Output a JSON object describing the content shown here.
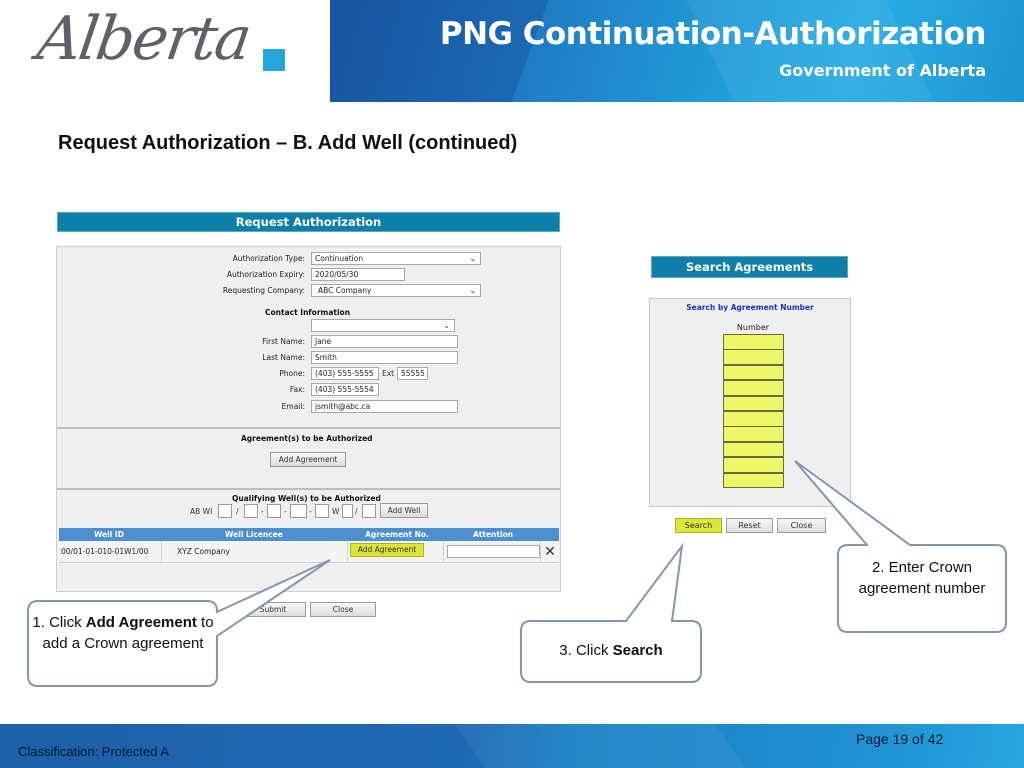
{
  "header": {
    "logo_text": "Alberta",
    "title": "PNG Continuation-Authorization",
    "subtitle": "Government of Alberta"
  },
  "slide_heading": "Request Authorization – B. Add Well (continued)",
  "request_form": {
    "title": "Request Authorization",
    "fields": {
      "authorization_type": {
        "label": "Authorization Type:",
        "value": "Continuation"
      },
      "authorization_expiry": {
        "label": "Authorization Expiry:",
        "value": "2020/05/30"
      },
      "requesting_company": {
        "label": "Requesting Company:",
        "value": "ABC Company"
      }
    },
    "contact": {
      "heading": "Contact Information",
      "contact_select_value": "",
      "first_name": {
        "label": "First Name:",
        "value": "Jane"
      },
      "last_name": {
        "label": "Last Name:",
        "value": "Smith"
      },
      "phone": {
        "label": "Phone:",
        "value": "(403) 555-5555",
        "ext_label": "Ext",
        "ext_value": "55555"
      },
      "fax": {
        "label": "Fax:",
        "value": "(403) 555-5554"
      },
      "email": {
        "label": "Email:",
        "value": "jsmith@abc.ca"
      }
    },
    "agreements": {
      "heading": "Agreement(s) to be Authorized",
      "add_button": "Add Agreement"
    },
    "wells": {
      "heading": "Qualifying Well(s) to be Authorized",
      "prefix": "AB WI",
      "sep_slash": "/",
      "sep_dash": "-",
      "sep_w": "W",
      "add_button": "Add Well",
      "columns": [
        "Well ID",
        "Well Licencee",
        "Agreement No.",
        "Attention"
      ],
      "rows": [
        {
          "well_id": "00/01-01-010-01W1/00",
          "licencee": "XYZ Company",
          "agreement_button": "Add Agreement",
          "attention": ""
        }
      ]
    },
    "submit_button": "Submit",
    "close_button": "Close"
  },
  "search_agreements": {
    "title": "Search Agreements",
    "subtitle": "Search by Agreement Number",
    "number_label": "Number",
    "number_fields": [
      "",
      "",
      "",
      "",
      "",
      "",
      "",
      "",
      "",
      ""
    ],
    "buttons": {
      "search": "Search",
      "reset": "Reset",
      "close": "Close"
    }
  },
  "callouts": {
    "step1": {
      "prefix": "1.  Click ",
      "bold": "Add Agreement",
      "suffix": "  to add a Crown agreement"
    },
    "step2": {
      "text": "2. Enter Crown agreement number"
    },
    "step3": {
      "prefix": "3. Click ",
      "bold": "Search"
    }
  },
  "footer": {
    "classification": "Classification: Protected A",
    "page": "Page 19 of 42"
  },
  "colors": {
    "banner_blue": "#1f76c0",
    "form_title_teal": "#0e7fa7",
    "highlight_yellow": "#dbe53a",
    "field_yellow": "#eef76a",
    "well_header_blue": "#4e8fd0",
    "callout_border": "#8496b0"
  }
}
